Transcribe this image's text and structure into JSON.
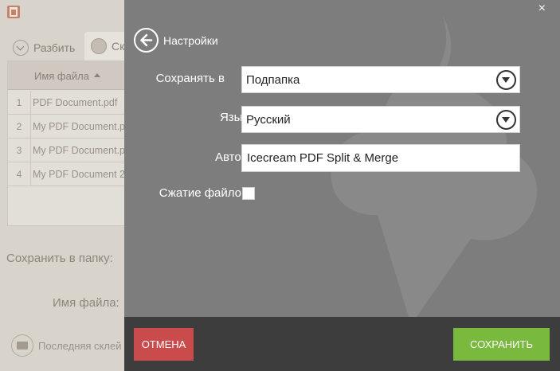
{
  "background_app": {
    "tabs": [
      {
        "label": "Разбить",
        "icon": "split-icon"
      },
      {
        "label": "Ск",
        "icon": "merge-icon"
      }
    ],
    "table": {
      "header": "Имя файла",
      "rows": [
        {
          "num": "1",
          "name": "PDF Document.pdf"
        },
        {
          "num": "2",
          "name": "My PDF Document.p"
        },
        {
          "num": "3",
          "name": "My PDF Document.p"
        },
        {
          "num": "4",
          "name": "My PDF Document 2"
        }
      ]
    },
    "save_folder_label": "Сохранить в папку:",
    "file_name_label": "Имя файла:",
    "last_merge_label": "Последняя склей"
  },
  "settings": {
    "title": "Настройки",
    "close_glyph": "×",
    "save_in": {
      "label": "Сохранять в",
      "value": "Подпапка"
    },
    "language": {
      "label": "Язык",
      "value": "Русский"
    },
    "author": {
      "label": "Автор",
      "value": "Icecream PDF Split & Merge"
    },
    "compress": {
      "label": "Сжатие файлов",
      "checked": false
    },
    "cancel_label": "ОТМЕНА",
    "save_label": "СОХРАНИТЬ"
  },
  "colors": {
    "panel_bg": "#7d7d7d",
    "bottom_bar": "#3d3d3d",
    "cancel": "#c94b4b",
    "save": "#79b93e"
  }
}
